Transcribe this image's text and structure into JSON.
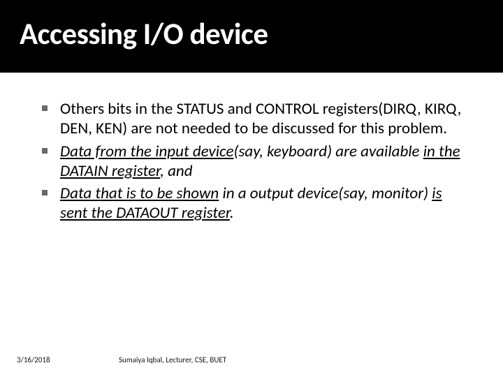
{
  "slide": {
    "title": "Accessing I/O device"
  },
  "bullets": {
    "b1": {
      "t1": "Others bits in the STATUS and CONTROL registers(DIRQ, KIRQ, DEN, KEN) are not needed to be discussed for this problem."
    },
    "b2": {
      "p1": "Data from the input device",
      "p2": "(say, keyboard) are available ",
      "p3": "in the DATAIN register",
      "p4": ", and"
    },
    "b3": {
      "p1": "Data that is to be shown",
      "p2": " in a output device(say, monitor) ",
      "p3": "is sent the DATAOUT register",
      "p4": "."
    }
  },
  "footer": {
    "date": "3/16/2018",
    "author": "Sumaiya Iqbal, Lecturer, CSE, BUET"
  }
}
